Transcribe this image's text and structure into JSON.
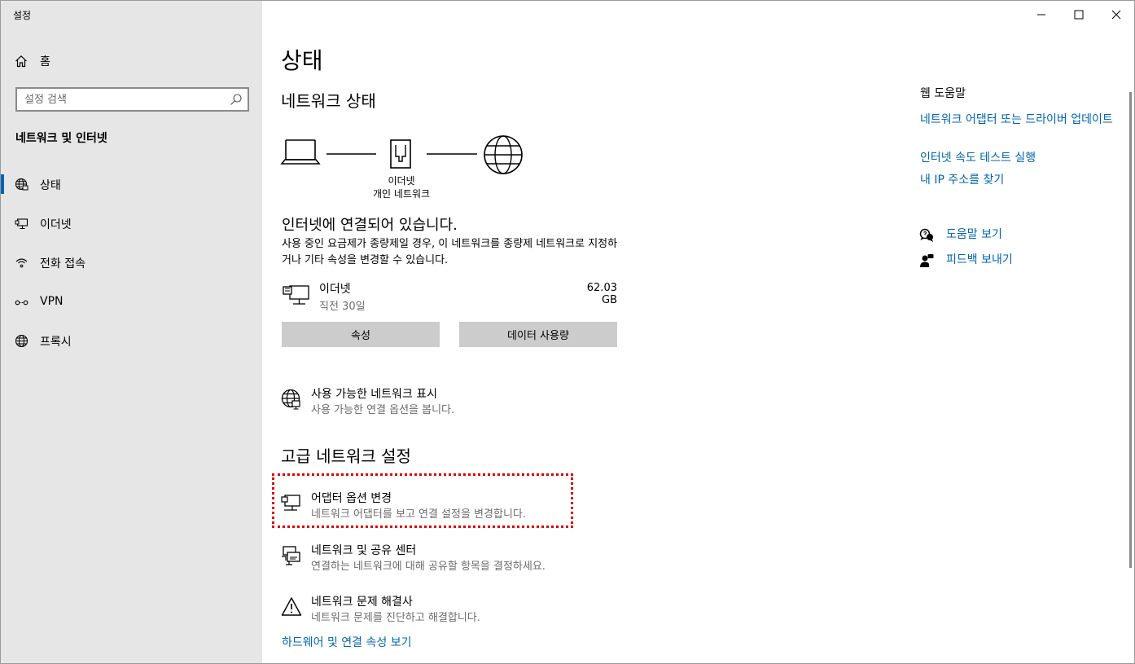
{
  "app": {
    "title": "설정"
  },
  "sidebar": {
    "home_label": "홈",
    "search_placeholder": "설정 검색",
    "section_title": "네트워크 및 인터넷",
    "items": [
      {
        "label": "상태",
        "icon": "globe-status-icon",
        "active": true
      },
      {
        "label": "이더넷",
        "icon": "ethernet-icon",
        "active": false
      },
      {
        "label": "전화 접속",
        "icon": "dialup-icon",
        "active": false
      },
      {
        "label": "VPN",
        "icon": "vpn-icon",
        "active": false
      },
      {
        "label": "프록시",
        "icon": "globe-icon",
        "active": false
      }
    ]
  },
  "main": {
    "page_title": "상태",
    "network_status_title": "네트워크 상태",
    "diagram": {
      "device_label": "이더넷",
      "network_label": "개인 네트워크"
    },
    "connection_title": "인터넷에 연결되어 있습니다.",
    "connection_desc": "사용 중인 요금제가 종량제일 경우, 이 네트워크를 종량제 네트워크로 지정하거나 기타 속성을 변경할 수 있습니다.",
    "adapter": {
      "name": "이더넷",
      "time": "직전 30일",
      "usage": "62.03 GB"
    },
    "buttons": {
      "properties": "속성",
      "data_usage": "데이터 사용량"
    },
    "show_networks": {
      "title": "사용 가능한 네트워크 표시",
      "desc": "사용 가능한 연결 옵션을 봅니다."
    },
    "advanced_title": "고급 네트워크 설정",
    "advanced": [
      {
        "title": "어댑터 옵션 변경",
        "desc": "네트워크 어댑터를 보고 연결 설정을 변경합니다.",
        "icon": "adapter-icon"
      },
      {
        "title": "네트워크 및 공유 센터",
        "desc": "연결하는 네트워크에 대해 공유할 항목을 결정하세요.",
        "icon": "sharing-center-icon"
      },
      {
        "title": "네트워크 문제 해결사",
        "desc": "네트워크 문제를 진단하고 해결합니다.",
        "icon": "warning-icon"
      }
    ],
    "hardware_link": "하드웨어 및 연결 속성 보기"
  },
  "right": {
    "help_title": "웹 도움말",
    "links": [
      "네트워크 어댑터 또는 드라이버 업데이트",
      "인터넷 속도 테스트 실행",
      "내 IP 주소를 찾기"
    ],
    "get_help": "도움말 보기",
    "feedback": "피드백 보내기"
  },
  "colors": {
    "accent": "#0063b1",
    "sidebar_bg": "#e6e6e6",
    "button_bg": "#cccccc",
    "highlight": "#e00000"
  }
}
